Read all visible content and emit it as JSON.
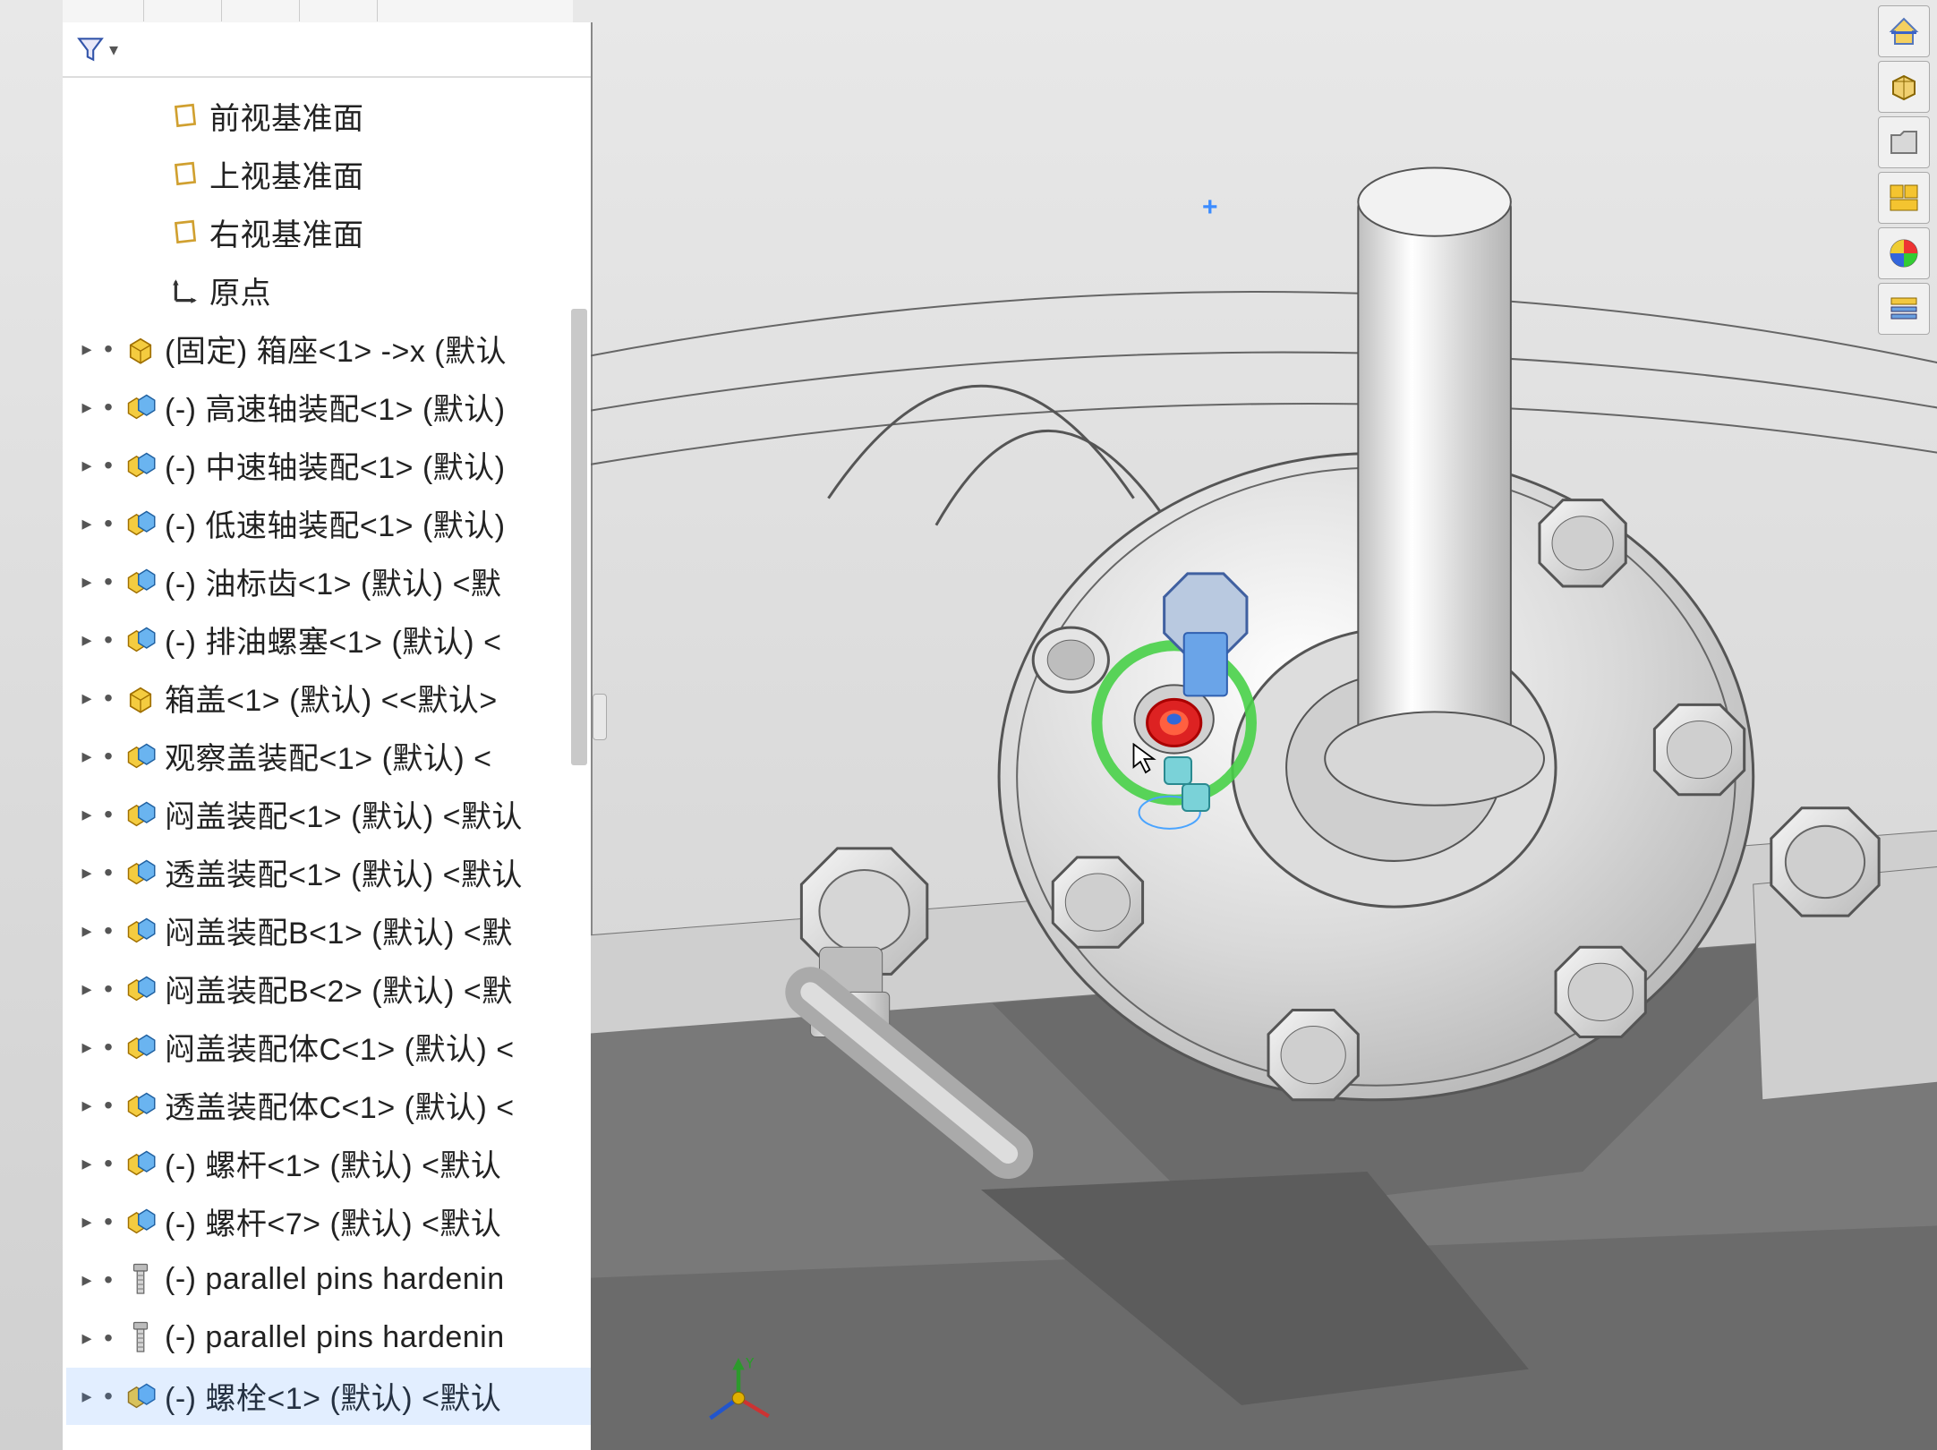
{
  "filter": {
    "placeholder": ""
  },
  "datum_planes": [
    {
      "label": "前视基准面"
    },
    {
      "label": "上视基准面"
    },
    {
      "label": "右视基准面"
    }
  ],
  "origin": {
    "label": "原点"
  },
  "components": [
    {
      "label": "(固定) 箱座<1> ->x (默认",
      "icon": "part"
    },
    {
      "label": "(-) 高速轴装配<1> (默认)",
      "icon": "asm"
    },
    {
      "label": "(-) 中速轴装配<1> (默认)",
      "icon": "asm"
    },
    {
      "label": "(-) 低速轴装配<1> (默认)",
      "icon": "asm"
    },
    {
      "label": "(-) 油标齿<1> (默认) <默",
      "icon": "asm"
    },
    {
      "label": "(-) 排油螺塞<1> (默认) <",
      "icon": "asm"
    },
    {
      "label": "箱盖<1> (默认) <<默认>",
      "icon": "part"
    },
    {
      "label": "观察盖装配<1> (默认) <",
      "icon": "asm"
    },
    {
      "label": "闷盖装配<1> (默认) <默认",
      "icon": "asm"
    },
    {
      "label": "透盖装配<1> (默认) <默认",
      "icon": "asm"
    },
    {
      "label": "闷盖装配B<1> (默认) <默",
      "icon": "asm"
    },
    {
      "label": "闷盖装配B<2> (默认) <默",
      "icon": "asm"
    },
    {
      "label": "闷盖装配体C<1> (默认) <",
      "icon": "asm"
    },
    {
      "label": "透盖装配体C<1> (默认) <",
      "icon": "asm"
    },
    {
      "label": "(-) 螺杆<1> (默认) <默认",
      "icon": "asm"
    },
    {
      "label": "(-) 螺杆<7> (默认) <默认",
      "icon": "asm"
    },
    {
      "label": "(-) parallel pins hardenin",
      "icon": "fastener"
    },
    {
      "label": "(-) parallel pins hardenin",
      "icon": "fastener"
    },
    {
      "label": "(-) 螺栓<1> (默认) <默认",
      "icon": "asm"
    }
  ],
  "right_tools": [
    {
      "name": "home-icon"
    },
    {
      "name": "isometric-icon"
    },
    {
      "name": "open-icon"
    },
    {
      "name": "display-style-icon"
    },
    {
      "name": "appearance-icon"
    },
    {
      "name": "scene-settings-icon"
    }
  ],
  "triad": {
    "y_label": "Y"
  },
  "highlight_index": 18
}
